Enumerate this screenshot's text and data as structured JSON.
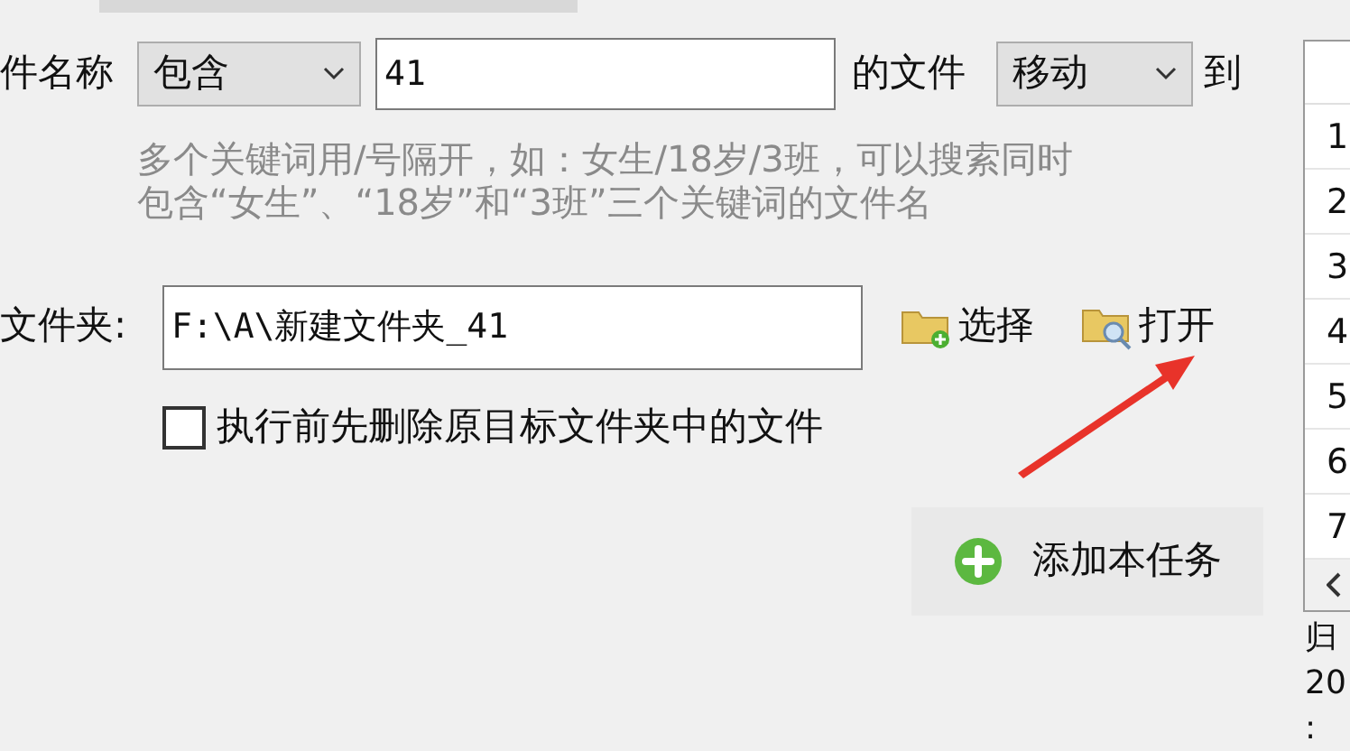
{
  "filter": {
    "label": "件名称",
    "match": {
      "value": "包含"
    },
    "keyword": {
      "value": "41"
    },
    "middle_label": "的文件",
    "action": {
      "value": "移动"
    },
    "to_label": "到"
  },
  "hint": [
    "多个关键词用/号隔开，如：女生/18岁/3班，可以搜索同时",
    "包含“女生”、“18岁”和“3班”三个关键词的文件名"
  ],
  "folder": {
    "label": "文件夹:",
    "path": "F:\\A\\新建文件夹_41"
  },
  "select_button": "选择",
  "open_button": "打开",
  "clear_option": {
    "label": "执行前先删除原目标文件夹中的文件",
    "checked": false
  },
  "add_button": "添加本任务",
  "task_list": {
    "rows": [
      "1",
      "2",
      "3",
      "4",
      "5",
      "6",
      "7"
    ]
  },
  "summary": [
    "归",
    "20",
    ":"
  ]
}
